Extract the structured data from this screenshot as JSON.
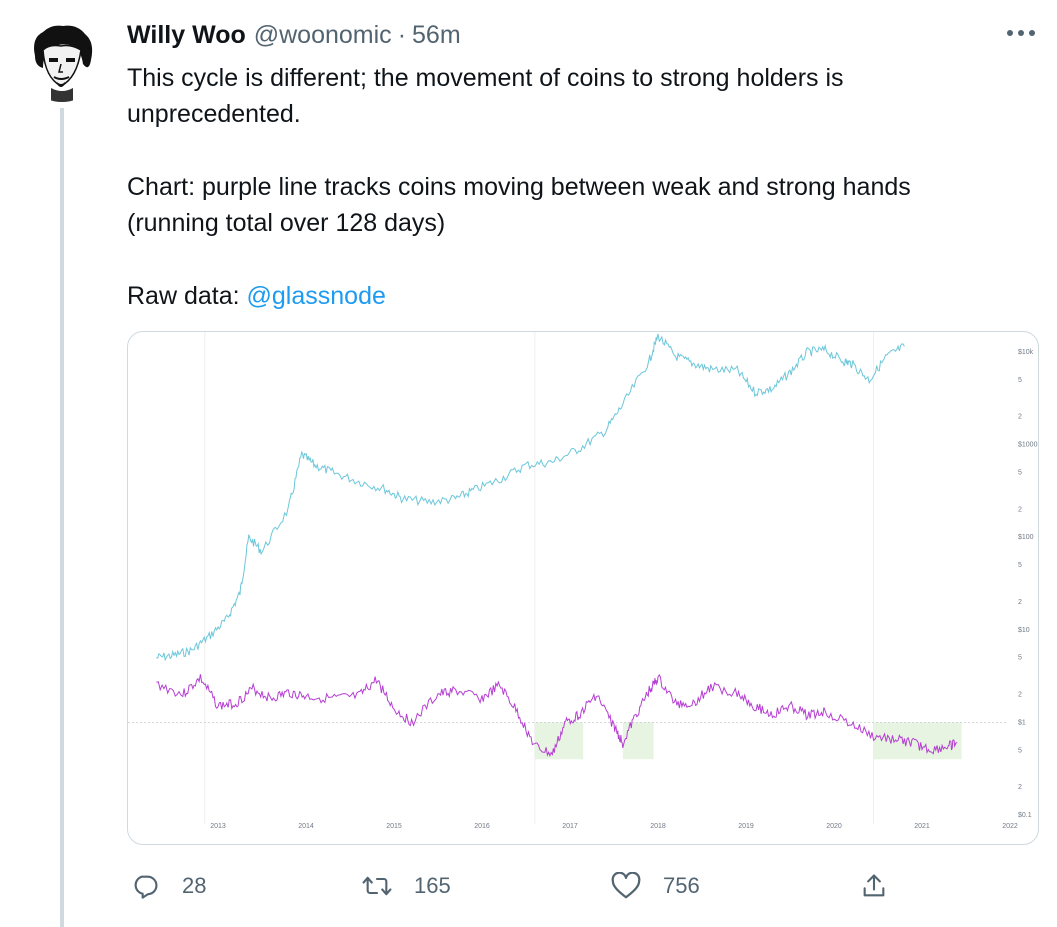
{
  "tweet": {
    "author_name": "Willy Woo",
    "author_handle": "@woonomic",
    "separator": "·",
    "timestamp": "56m",
    "text_line1": "This cycle is different; the movement of coins to strong holders is unprecedented.",
    "text_line2": "Chart: purple line tracks coins moving between weak and strong hands (running total over 128 days)",
    "text_line3_prefix": "Raw data: ",
    "mention": "@glassnode",
    "more_icon": "more-horizontal-icon"
  },
  "actions": {
    "reply": {
      "icon": "reply-icon",
      "count": "28"
    },
    "retweet": {
      "icon": "retweet-icon",
      "count": "165"
    },
    "like": {
      "icon": "like-heart-icon",
      "count": "756"
    },
    "share": {
      "icon": "share-icon"
    }
  },
  "colors": {
    "accent": "#1d9bf0",
    "price_line": "#6cc7d9",
    "indicator_line": "#b63fd3",
    "highlight_zone": "#dff0d8"
  },
  "chart_data": {
    "type": "line",
    "x_axis_labels": [
      "2013",
      "2014",
      "2015",
      "2016",
      "2017",
      "2018",
      "2019",
      "2020",
      "2021",
      "2022"
    ],
    "y_axis_labels": [
      "$10k",
      "5",
      "2",
      "$1000",
      "5",
      "2",
      "$100",
      "5",
      "2",
      "$10",
      "5",
      "2",
      "$1",
      "5",
      "2",
      "$0.1"
    ],
    "y_scale": "log",
    "series": [
      {
        "x": [
          2012.3,
          2012.5,
          2012.7,
          2012.9,
          2013.1,
          2013.25,
          2013.35,
          2013.5,
          2013.8,
          2013.95,
          2014.1,
          2014.3,
          2014.6,
          2014.9,
          2015.1,
          2015.4,
          2015.7,
          2015.9,
          2016.2,
          2016.5,
          2016.8,
          2017.1,
          2017.4,
          2017.6,
          2017.9,
          2018.0,
          2018.2,
          2018.4,
          2018.6,
          2018.9,
          2019.1,
          2019.3,
          2019.5,
          2019.7,
          2019.9,
          2020.1,
          2020.2,
          2020.4,
          2020.6,
          2020.8
        ],
        "y": [
          5,
          5.3,
          6,
          8.5,
          13,
          25,
          100,
          70,
          200,
          780,
          600,
          500,
          400,
          330,
          260,
          240,
          260,
          320,
          420,
          600,
          650,
          900,
          1400,
          2700,
          8000,
          15000,
          9000,
          7500,
          6500,
          6300,
          3700,
          4000,
          6000,
          10000,
          10500,
          8000,
          7500,
          5000,
          9000,
          11500
        ]
      },
      {
        "x": [
          2012.3,
          2012.6,
          2012.8,
          2013.0,
          2013.2,
          2013.4,
          2013.6,
          2013.8,
          2014.0,
          2014.3,
          2014.6,
          2014.8,
          2015.0,
          2015.2,
          2015.5,
          2015.7,
          2016.0,
          2016.2,
          2016.4,
          2016.6,
          2016.8,
          2016.95,
          2017.1,
          2017.3,
          2017.5,
          2017.6,
          2017.75,
          2017.9,
          2018.0,
          2018.2,
          2018.4,
          2018.6,
          2018.9,
          2019.1,
          2019.3,
          2019.5,
          2019.7,
          2019.9,
          2020.2,
          2020.45,
          2020.7,
          2020.9,
          2021.1,
          2021.3,
          2021.4
        ],
        "y": [
          2.6,
          2.0,
          3.0,
          1.5,
          1.6,
          2.3,
          1.8,
          2.1,
          1.9,
          1.8,
          1.9,
          2.9,
          1.4,
          1.0,
          2.0,
          2.2,
          1.8,
          2.5,
          1.3,
          0.55,
          0.45,
          1.0,
          1.2,
          2.0,
          0.9,
          0.6,
          1.2,
          2.2,
          3.0,
          1.6,
          1.6,
          2.4,
          2.1,
          1.5,
          1.2,
          1.5,
          1.2,
          1.3,
          0.95,
          0.7,
          0.65,
          0.6,
          0.5,
          0.55,
          0.6
        ]
      }
    ],
    "reference_line_y": 1,
    "highlight_ranges_x": [
      [
        2016.6,
        2017.15
      ],
      [
        2017.6,
        2017.95
      ],
      [
        2020.45,
        2021.45
      ]
    ]
  }
}
